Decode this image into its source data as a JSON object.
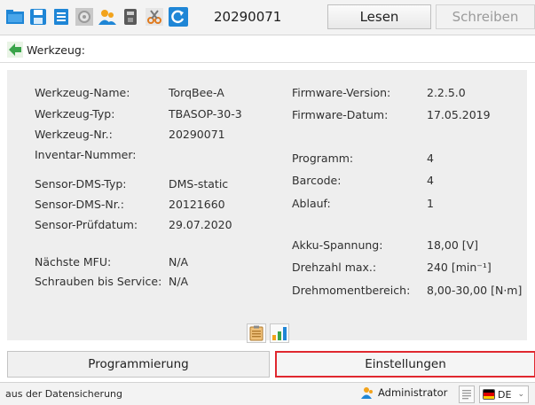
{
  "toolbar": {
    "tool_id": "20290071",
    "read_button": "Lesen",
    "write_button": "Schreiben",
    "icons": [
      "folder-open-icon",
      "save-icon",
      "print-icon",
      "settings-icon",
      "users-icon",
      "tool-icon",
      "scissors-icon",
      "refresh-icon"
    ]
  },
  "breadcrumb": {
    "title": "Werkzeug:"
  },
  "left_fields": [
    {
      "label": "Werkzeug-Name:",
      "value": "TorqBee-A"
    },
    {
      "label": "Werkzeug-Typ:",
      "value": "TBASOP-30-3"
    },
    {
      "label": "Werkzeug-Nr.:",
      "value": "20290071"
    },
    {
      "label": "Inventar-Nummer:",
      "value": ""
    },
    {
      "label": "Sensor-DMS-Typ:",
      "value": "DMS-static"
    },
    {
      "label": "Sensor-DMS-Nr.:",
      "value": "20121660"
    },
    {
      "label": "Sensor-Prüfdatum:",
      "value": "29.07.2020"
    },
    {
      "label": "Nächste MFU:",
      "value": "N/A"
    },
    {
      "label": "Schrauben bis Service:",
      "value": "N/A"
    }
  ],
  "right_fields": [
    {
      "label": "Firmware-Version:",
      "value": "2.2.5.0"
    },
    {
      "label": "Firmware-Datum:",
      "value": "17.05.2019"
    },
    {
      "label": "Programm:",
      "value": "4"
    },
    {
      "label": "Barcode:",
      "value": "4"
    },
    {
      "label": "Ablauf:",
      "value": "1"
    },
    {
      "label": "Akku-Spannung:",
      "value": "18,00 [V]"
    },
    {
      "label": "Drehzahl max.:",
      "value": "240 [min⁻¹]"
    },
    {
      "label": "Drehmomentbereich:",
      "value": "8,00-30,00 [N·m]"
    }
  ],
  "nav": {
    "programming": "Programmierung",
    "settings": "Einstellungen"
  },
  "status": {
    "message": "aus der Datensicherung",
    "user": "Administrator",
    "language": "DE"
  },
  "colors": {
    "accent_red": "#e0282f",
    "icon_blue": "#1f86d6",
    "panel_bg": "#eeeeee"
  }
}
